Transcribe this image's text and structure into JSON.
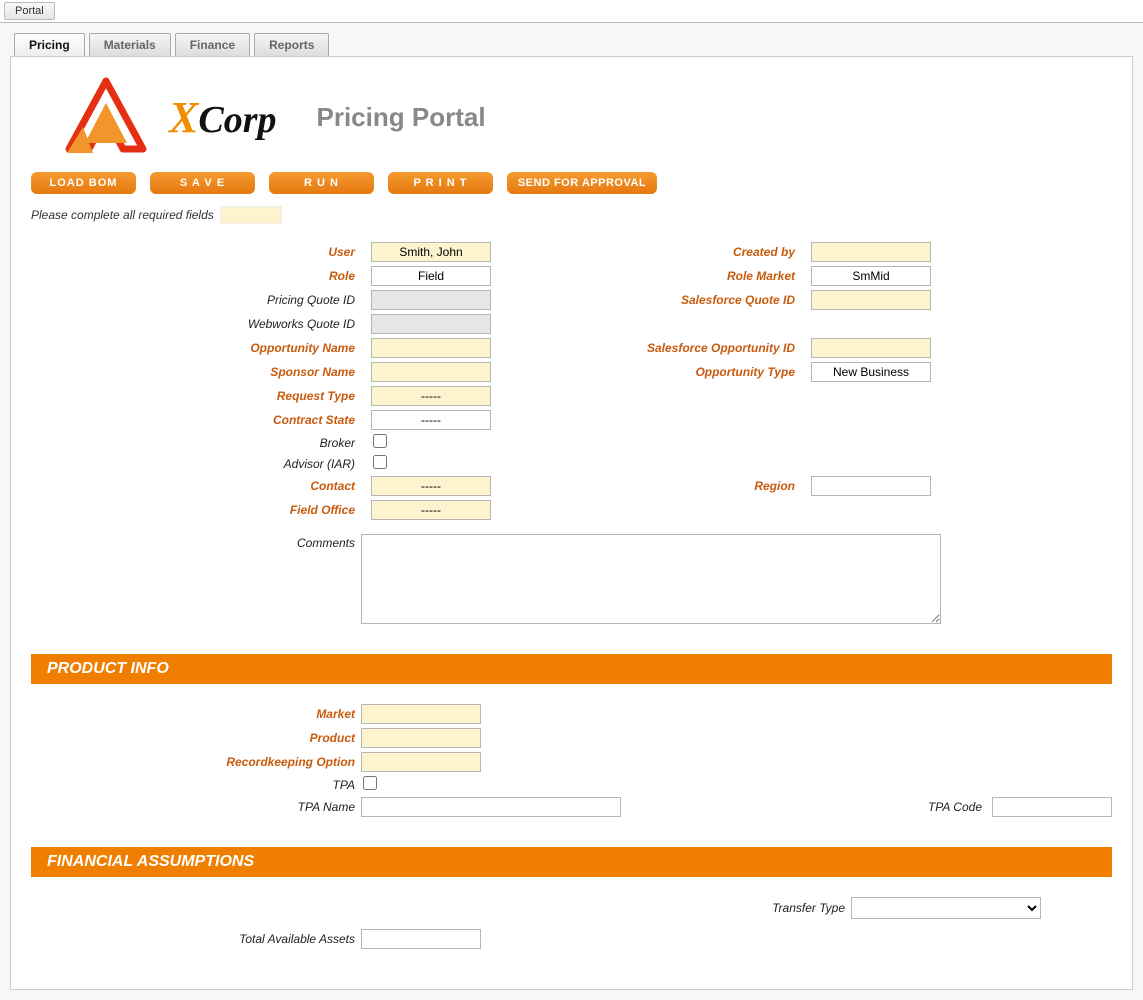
{
  "portal_button": "Portal",
  "tabs": [
    "Pricing",
    "Materials",
    "Finance",
    "Reports"
  ],
  "active_tab_index": 0,
  "logo": {
    "x": "X",
    "corp": "Corp"
  },
  "page_title": "Pricing Portal",
  "actions": {
    "load_bom": "LOAD BOM",
    "save": "S A V E",
    "run": "R U N",
    "print": "P R I N T",
    "send_approval": "SEND  FOR APPROVAL"
  },
  "instruction": "Please complete all required fields",
  "fields": {
    "user_label": "User",
    "user_value": "Smith, John",
    "created_by_label": "Created by",
    "created_by_value": "",
    "role_label": "Role",
    "role_value": "Field",
    "role_market_label": "Role Market",
    "role_market_value": "SmMid",
    "pricing_quote_id_label": "Pricing Quote ID",
    "pricing_quote_id_value": "",
    "sf_quote_id_label": "Salesforce Quote ID",
    "sf_quote_id_value": "",
    "webworks_quote_id_label": "Webworks Quote ID",
    "webworks_quote_id_value": "",
    "opportunity_name_label": "Opportunity Name",
    "opportunity_name_value": "",
    "sf_opportunity_id_label": "Salesforce Opportunity ID",
    "sf_opportunity_id_value": "",
    "sponsor_name_label": "Sponsor Name",
    "sponsor_name_value": "",
    "opportunity_type_label": "Opportunity Type",
    "opportunity_type_value": "New Business",
    "request_type_label": "Request Type",
    "request_type_value": "-----",
    "contract_state_label": "Contract State",
    "contract_state_value": "-----",
    "broker_label": "Broker",
    "advisor_label": "Advisor (IAR)",
    "contact_label": "Contact",
    "contact_value": "-----",
    "region_label": "Region",
    "region_value": "",
    "field_office_label": "Field Office",
    "field_office_value": "-----",
    "comments_label": "Comments",
    "comments_value": ""
  },
  "sections": {
    "product_info": "PRODUCT INFO",
    "financial_assumptions": "FINANCIAL ASSUMPTIONS"
  },
  "product": {
    "market_label": "Market",
    "market_value": "",
    "product_label": "Product",
    "product_value": "",
    "recordkeeping_label": "Recordkeeping Option",
    "recordkeeping_value": "",
    "tpa_label": "TPA",
    "tpa_name_label": "TPA Name",
    "tpa_name_value": "",
    "tpa_code_label": "TPA Code",
    "tpa_code_value": ""
  },
  "financial": {
    "transfer_type_label": "Transfer Type",
    "transfer_type_value": "",
    "total_assets_label": "Total Available Assets",
    "total_assets_value": ""
  }
}
